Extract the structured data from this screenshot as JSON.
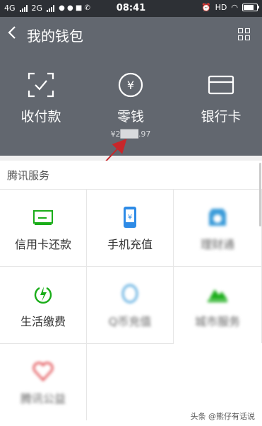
{
  "status_bar": {
    "network1": "4G",
    "network2": "2G",
    "time": "08:41",
    "hd": "HD"
  },
  "header": {
    "back_icon": "chevron-left-icon",
    "title": "我的钱包",
    "menu_icon": "grid-icon"
  },
  "actions": [
    {
      "label": "收付款",
      "icon": "scan-check-icon"
    },
    {
      "label": "零钱",
      "icon": "yen-circle-icon",
      "balance": "¥2███.97"
    },
    {
      "label": "银行卡",
      "icon": "card-icon"
    }
  ],
  "services": {
    "title": "腾讯服务",
    "items": [
      {
        "label": "信用卡还款",
        "icon": "credit-card-icon",
        "color": "#1aad19"
      },
      {
        "label": "手机充值",
        "icon": "phone-icon",
        "color": "#2e8be6"
      },
      {
        "label": "理财通",
        "icon": "lct-icon",
        "color": "#3a9bd9",
        "blurred": true
      },
      {
        "label": "生活缴费",
        "icon": "lightning-icon",
        "color": "#1aad19"
      },
      {
        "label": "Q币充值",
        "icon": "qq-icon",
        "color": "#3a9bd9",
        "blurred": true
      },
      {
        "label": "城市服务",
        "icon": "city-icon",
        "color": "#1aad19",
        "blurred": true
      },
      {
        "label": "腾讯公益",
        "icon": "heart-icon",
        "color": "#e0464b",
        "blurred": true
      }
    ]
  },
  "watermark": "头条 @熊仔有话说"
}
